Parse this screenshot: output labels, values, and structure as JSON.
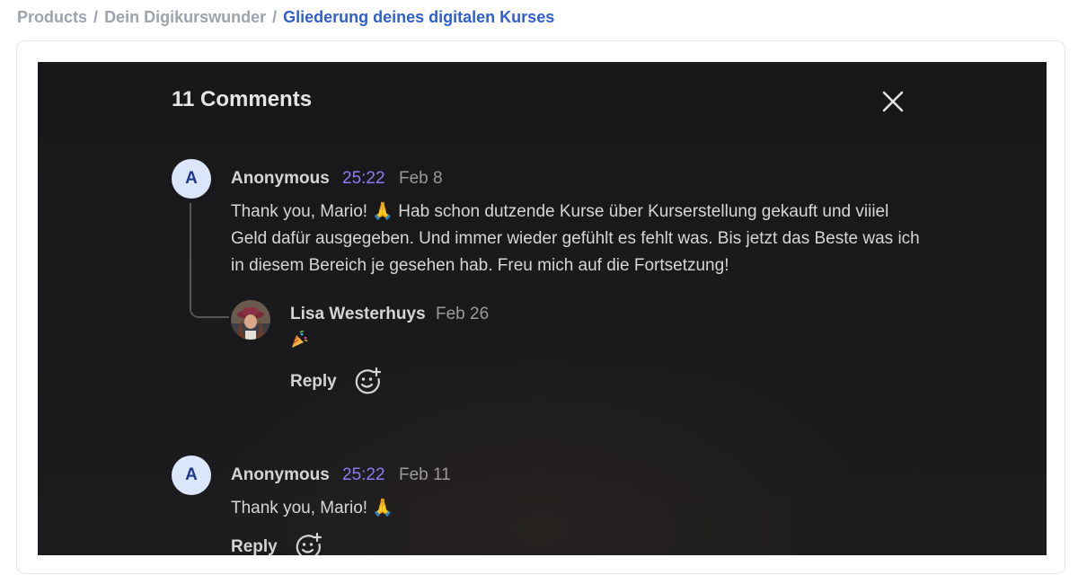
{
  "breadcrumb": {
    "items": [
      "Products",
      "Dein Digikurswunder"
    ],
    "current": "Gliederung deines digitalen Kurses",
    "separator": "/"
  },
  "comments_panel": {
    "title": "11 Comments",
    "close_icon": "close-icon",
    "comments": [
      {
        "avatar_letter": "A",
        "author": "Anonymous",
        "timestamp": "25:22",
        "date": "Feb 8",
        "text": "Thank you, Mario! 🙏 Hab schon dutzende Kurse über Kurserstellung gekauft und viiiel Geld dafür ausgegeben. Und immer wieder gefühlt es fehlt was. Bis jetzt das Beste was ich in diesem Bereich je gesehen hab. Freu mich auf die Fortsetzung!",
        "replies": [
          {
            "author": "Lisa Westerhuys",
            "date": "Feb 26",
            "text_icon": "party-popper-icon",
            "reply_label": "Reply",
            "react_icon": "add-reaction-icon"
          }
        ]
      },
      {
        "avatar_letter": "A",
        "author": "Anonymous",
        "timestamp": "25:22",
        "date": "Feb 11",
        "text": "Thank you, Mario! 🙏",
        "reply_label": "Reply",
        "react_icon": "add-reaction-icon"
      }
    ]
  },
  "colors": {
    "breadcrumb_muted": "#9ca3af",
    "breadcrumb_active": "#2f5fd0",
    "panel_bg": "#1c1c1e",
    "timestamp": "#8b7cf6",
    "avatar_bg": "#dbe6fb",
    "avatar_text": "#1e3a8a"
  }
}
